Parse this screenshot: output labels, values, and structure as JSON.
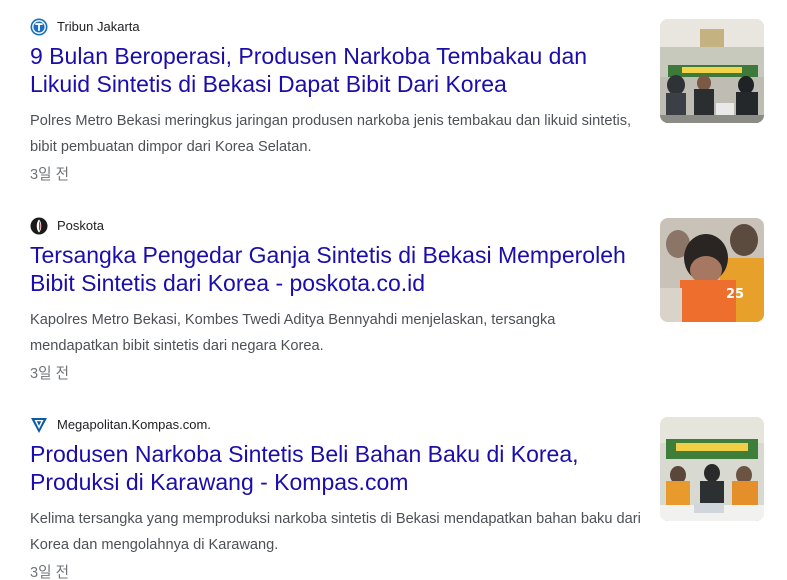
{
  "articles": [
    {
      "source": "Tribun Jakarta",
      "source_icon": "tribun-logo-icon",
      "headline": "9 Bulan Beroperasi, Produsen Narkoba Tembakau dan Likuid Sintetis di Bekasi Dapat Bibit Dari Korea",
      "snippet": "Polres Metro Bekasi meringkus jaringan produsen narkoba jenis tembakau dan likuid sintetis, bibit pembuatan dimpor dari Korea Selatan.",
      "age": "3일 전",
      "thumbnail": "press-conference-thumbnail"
    },
    {
      "source": "Poskota",
      "source_icon": "poskota-logo-icon",
      "headline": "Tersangka Pengedar Ganja Sintetis di Bekasi Memperoleh Bibit Sintetis dari Korea - poskota.co.id",
      "snippet": "Kapolres Metro Bekasi, Kombes Twedi Aditya Bennyahdi menjelaskan, tersangka mendapatkan bibit sintetis dari negara Korea.",
      "age": "3일 전",
      "thumbnail": "suspects-in-orange-shirts-thumbnail"
    },
    {
      "source": "Megapolitan.Kompas.com.",
      "source_icon": "kompas-logo-icon",
      "headline": "Produsen Narkoba Sintetis Beli Bahan Baku di Korea, Produksi di Karawang - Kompas.com",
      "snippet": "Kelima tersangka yang memproduksi narkoba sintetis di Bekasi mendapatkan bahan baku dari Korea dan mengolahnya di Karawang.",
      "age": "3일 전",
      "thumbnail": "press-conference-thumbnail"
    }
  ],
  "colors": {
    "headline_link": "#1a0dab",
    "snippet_text": "#4d5156",
    "age_text": "#70757a",
    "source_text": "#202124"
  }
}
